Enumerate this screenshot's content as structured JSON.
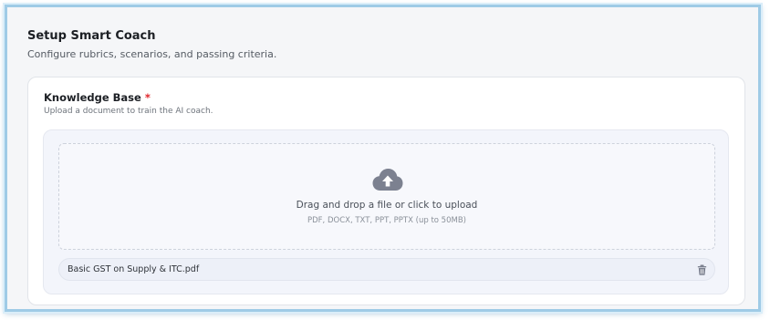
{
  "page": {
    "title": "Setup Smart Coach",
    "subtitle": "Configure rubrics, scenarios, and passing criteria."
  },
  "knowledge_base": {
    "title": "Knowledge Base",
    "required_mark": "*",
    "subtitle": "Upload a document to train the AI coach.",
    "upload": {
      "icon": "cloud-upload-icon",
      "prompt": "Drag and drop a file or click to upload",
      "hint": "PDF, DOCX, TXT, PPT, PPTX (up to 50MB)"
    },
    "files": [
      {
        "name": "Basic GST on Supply & ITC.pdf",
        "action_icon": "trash-icon"
      }
    ]
  },
  "colors": {
    "frame_border": "#9fcbe6",
    "background": "#f5f6f8",
    "required": "#e0262b",
    "icon": "#7c8190"
  }
}
